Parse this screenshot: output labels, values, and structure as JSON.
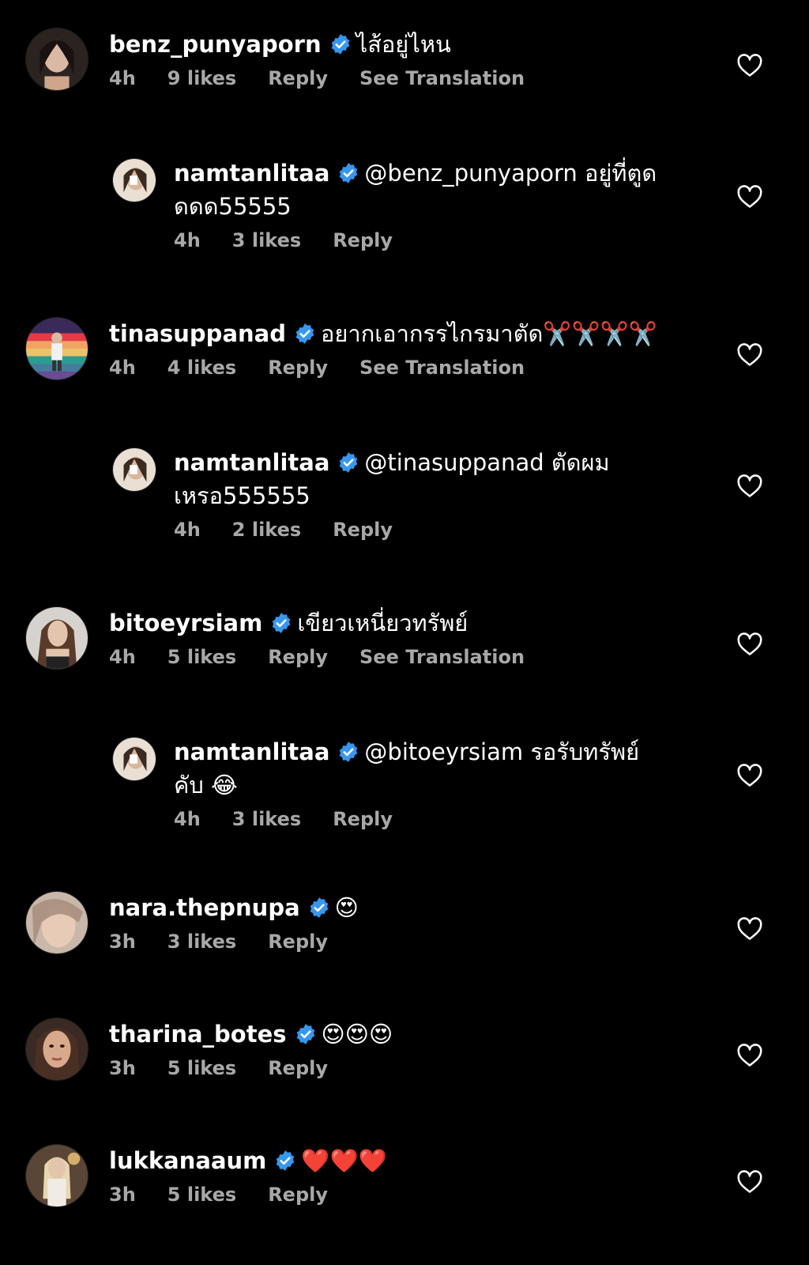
{
  "comments": [
    {
      "username": "benz_punyaporn",
      "text": "ไส้อยู่ไหน",
      "time": "4h",
      "likes": "9 likes",
      "reply": "Reply",
      "translate": "See Translation"
    },
    {
      "username": "namtanlitaa",
      "text": "@benz_punyaporn อยู่ที่ตูดดดด55555",
      "time": "4h",
      "likes": "3 likes",
      "reply": "Reply"
    },
    {
      "username": "tinasuppanad",
      "text": "อยากเอากรรไกรมาตัด✂️✂️✂️✂️",
      "time": "4h",
      "likes": "4 likes",
      "reply": "Reply",
      "translate": "See Translation"
    },
    {
      "username": "namtanlitaa",
      "text": "@tinasuppanad ตัดผมเหรอ555555",
      "time": "4h",
      "likes": "2 likes",
      "reply": "Reply"
    },
    {
      "username": "bitoeyrsiam",
      "text": "เขียวเหนี่ยวทรัพย์",
      "time": "4h",
      "likes": "5 likes",
      "reply": "Reply",
      "translate": "See Translation"
    },
    {
      "username": "namtanlitaa",
      "text": "@bitoeyrsiam รอรับทรัพย์คับ 😂",
      "time": "4h",
      "likes": "3 likes",
      "reply": "Reply"
    },
    {
      "username": "nara.thepnupa",
      "text": "😍",
      "time": "3h",
      "likes": "3 likes",
      "reply": "Reply"
    },
    {
      "username": "tharina_botes",
      "text": "😍😍😍",
      "time": "3h",
      "likes": "5 likes",
      "reply": "Reply"
    },
    {
      "username": "lukkanaaum",
      "text": "❤️❤️❤️",
      "time": "3h",
      "likes": "5 likes",
      "reply": "Reply"
    }
  ],
  "icons": {
    "verified": "verified-badge-icon",
    "like": "heart-outline-icon"
  },
  "colors": {
    "background": "#000000",
    "text": "#ffffff",
    "meta": "#a8a8a8",
    "verified": "#3797f0"
  }
}
